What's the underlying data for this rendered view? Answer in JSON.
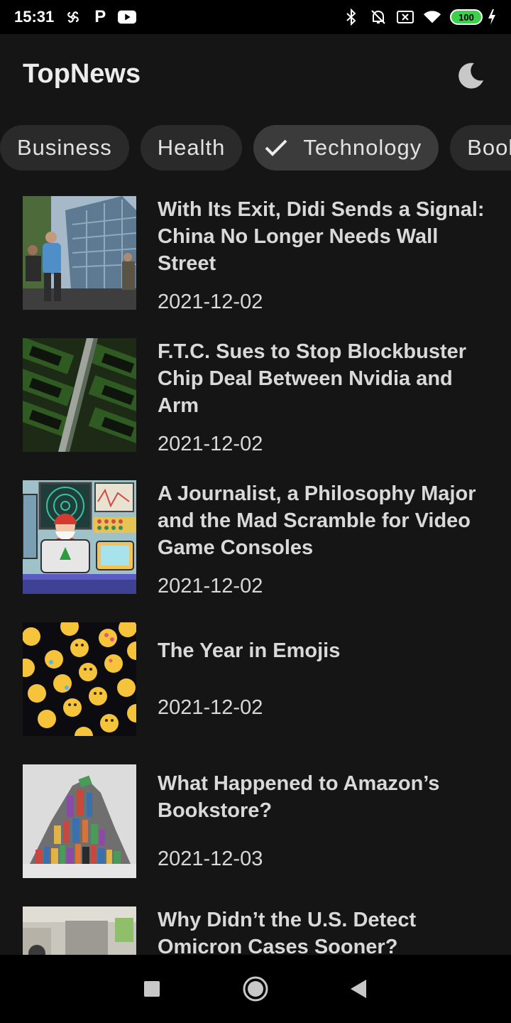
{
  "status_bar": {
    "time": "15:31",
    "left_icons": [
      "pinwheel-icon",
      "p-icon",
      "youtube-icon"
    ],
    "right_icons": [
      "bluetooth-icon",
      "mute-icon",
      "sim-icon",
      "wifi-icon",
      "battery-icon",
      "charging-icon"
    ],
    "p_glyph": "P",
    "battery": "100"
  },
  "app_bar": {
    "title": "TopNews",
    "theme_icon": "moon-icon"
  },
  "categories": {
    "items": [
      {
        "label": "Business",
        "selected": false
      },
      {
        "label": "Health",
        "selected": false
      },
      {
        "label": "Technology",
        "selected": true
      },
      {
        "label": "Books",
        "selected": false
      }
    ]
  },
  "news": {
    "items": [
      {
        "title": "With Its Exit, Didi Sends a Signal: China No Longer Needs Wall Street",
        "date": "2021-12-02",
        "thumb": "building-street-photo"
      },
      {
        "title": "F.T.C. Sues to Stop Blockbuster Chip Deal Between Nvidia and Arm",
        "date": "2021-12-02",
        "thumb": "nvidia-chips-photo"
      },
      {
        "title": "A Journalist, a Philosophy Major and the Mad Scramble for Video Game Consoles",
        "date": "2021-12-02",
        "thumb": "santa-illustration"
      },
      {
        "title": "The Year in Emojis",
        "date": "2021-12-02",
        "thumb": "emojis-photo"
      },
      {
        "title": "What Happened to Amazon’s Bookstore?",
        "date": "2021-12-03",
        "thumb": "book-pile-photo"
      },
      {
        "title": "Why Didn’t the U.S. Detect Omicron Cases Sooner?",
        "date": "",
        "thumb": "lab-photo"
      }
    ]
  },
  "nav_bar": {
    "buttons": [
      "recents-square-icon",
      "home-circle-icon",
      "back-triangle-icon"
    ]
  },
  "colors": {
    "background": "#151515",
    "chip": "#2a2a2a",
    "chip_selected": "#3b3b3b",
    "text": "#d9d9d9",
    "battery": "#3cd04a"
  }
}
